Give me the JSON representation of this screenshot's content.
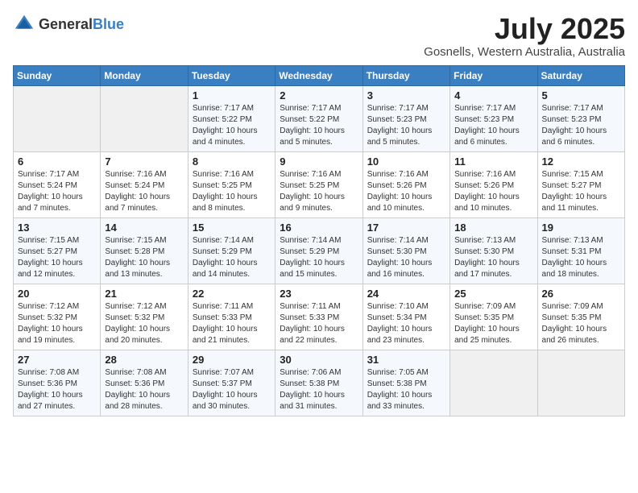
{
  "logo": {
    "general": "General",
    "blue": "Blue"
  },
  "header": {
    "month": "July 2025",
    "location": "Gosnells, Western Australia, Australia"
  },
  "weekdays": [
    "Sunday",
    "Monday",
    "Tuesday",
    "Wednesday",
    "Thursday",
    "Friday",
    "Saturday"
  ],
  "weeks": [
    [
      {
        "day": "",
        "info": ""
      },
      {
        "day": "",
        "info": ""
      },
      {
        "day": "1",
        "info": "Sunrise: 7:17 AM\nSunset: 5:22 PM\nDaylight: 10 hours and 4 minutes."
      },
      {
        "day": "2",
        "info": "Sunrise: 7:17 AM\nSunset: 5:22 PM\nDaylight: 10 hours and 5 minutes."
      },
      {
        "day": "3",
        "info": "Sunrise: 7:17 AM\nSunset: 5:23 PM\nDaylight: 10 hours and 5 minutes."
      },
      {
        "day": "4",
        "info": "Sunrise: 7:17 AM\nSunset: 5:23 PM\nDaylight: 10 hours and 6 minutes."
      },
      {
        "day": "5",
        "info": "Sunrise: 7:17 AM\nSunset: 5:23 PM\nDaylight: 10 hours and 6 minutes."
      }
    ],
    [
      {
        "day": "6",
        "info": "Sunrise: 7:17 AM\nSunset: 5:24 PM\nDaylight: 10 hours and 7 minutes."
      },
      {
        "day": "7",
        "info": "Sunrise: 7:16 AM\nSunset: 5:24 PM\nDaylight: 10 hours and 7 minutes."
      },
      {
        "day": "8",
        "info": "Sunrise: 7:16 AM\nSunset: 5:25 PM\nDaylight: 10 hours and 8 minutes."
      },
      {
        "day": "9",
        "info": "Sunrise: 7:16 AM\nSunset: 5:25 PM\nDaylight: 10 hours and 9 minutes."
      },
      {
        "day": "10",
        "info": "Sunrise: 7:16 AM\nSunset: 5:26 PM\nDaylight: 10 hours and 10 minutes."
      },
      {
        "day": "11",
        "info": "Sunrise: 7:16 AM\nSunset: 5:26 PM\nDaylight: 10 hours and 10 minutes."
      },
      {
        "day": "12",
        "info": "Sunrise: 7:15 AM\nSunset: 5:27 PM\nDaylight: 10 hours and 11 minutes."
      }
    ],
    [
      {
        "day": "13",
        "info": "Sunrise: 7:15 AM\nSunset: 5:27 PM\nDaylight: 10 hours and 12 minutes."
      },
      {
        "day": "14",
        "info": "Sunrise: 7:15 AM\nSunset: 5:28 PM\nDaylight: 10 hours and 13 minutes."
      },
      {
        "day": "15",
        "info": "Sunrise: 7:14 AM\nSunset: 5:29 PM\nDaylight: 10 hours and 14 minutes."
      },
      {
        "day": "16",
        "info": "Sunrise: 7:14 AM\nSunset: 5:29 PM\nDaylight: 10 hours and 15 minutes."
      },
      {
        "day": "17",
        "info": "Sunrise: 7:14 AM\nSunset: 5:30 PM\nDaylight: 10 hours and 16 minutes."
      },
      {
        "day": "18",
        "info": "Sunrise: 7:13 AM\nSunset: 5:30 PM\nDaylight: 10 hours and 17 minutes."
      },
      {
        "day": "19",
        "info": "Sunrise: 7:13 AM\nSunset: 5:31 PM\nDaylight: 10 hours and 18 minutes."
      }
    ],
    [
      {
        "day": "20",
        "info": "Sunrise: 7:12 AM\nSunset: 5:32 PM\nDaylight: 10 hours and 19 minutes."
      },
      {
        "day": "21",
        "info": "Sunrise: 7:12 AM\nSunset: 5:32 PM\nDaylight: 10 hours and 20 minutes."
      },
      {
        "day": "22",
        "info": "Sunrise: 7:11 AM\nSunset: 5:33 PM\nDaylight: 10 hours and 21 minutes."
      },
      {
        "day": "23",
        "info": "Sunrise: 7:11 AM\nSunset: 5:33 PM\nDaylight: 10 hours and 22 minutes."
      },
      {
        "day": "24",
        "info": "Sunrise: 7:10 AM\nSunset: 5:34 PM\nDaylight: 10 hours and 23 minutes."
      },
      {
        "day": "25",
        "info": "Sunrise: 7:09 AM\nSunset: 5:35 PM\nDaylight: 10 hours and 25 minutes."
      },
      {
        "day": "26",
        "info": "Sunrise: 7:09 AM\nSunset: 5:35 PM\nDaylight: 10 hours and 26 minutes."
      }
    ],
    [
      {
        "day": "27",
        "info": "Sunrise: 7:08 AM\nSunset: 5:36 PM\nDaylight: 10 hours and 27 minutes."
      },
      {
        "day": "28",
        "info": "Sunrise: 7:08 AM\nSunset: 5:36 PM\nDaylight: 10 hours and 28 minutes."
      },
      {
        "day": "29",
        "info": "Sunrise: 7:07 AM\nSunset: 5:37 PM\nDaylight: 10 hours and 30 minutes."
      },
      {
        "day": "30",
        "info": "Sunrise: 7:06 AM\nSunset: 5:38 PM\nDaylight: 10 hours and 31 minutes."
      },
      {
        "day": "31",
        "info": "Sunrise: 7:05 AM\nSunset: 5:38 PM\nDaylight: 10 hours and 33 minutes."
      },
      {
        "day": "",
        "info": ""
      },
      {
        "day": "",
        "info": ""
      }
    ]
  ]
}
